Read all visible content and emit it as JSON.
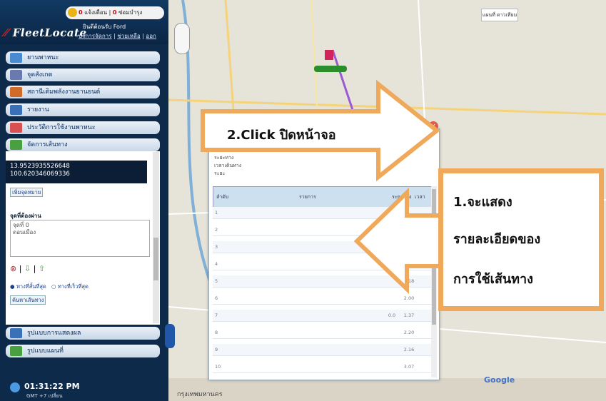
{
  "header": {
    "alert_count_1": "0",
    "alert_label_1": "แจ้งเตือน",
    "alert_count_2": "0",
    "alert_label_2": "ซ่อมบำรุง",
    "logo": "FleetLocate",
    "user_name": "ยินดีต้อนรับ Ford",
    "link_services": "บริการจัดการ",
    "link_help": "ช่วยเหลือ",
    "link_logout": "ออก"
  },
  "sidebar": {
    "items": [
      {
        "label": "ยานพาหนะ",
        "icon": "vehicle-icon",
        "color": "#4a8ad0"
      },
      {
        "label": "จุดสังเกต",
        "icon": "home-icon",
        "color": "#6a7ab0"
      },
      {
        "label": "สถานีเติมพลังงานยานยนต์",
        "icon": "fuel-pump-icon",
        "color": "#d06b2a"
      },
      {
        "label": "รายงาน",
        "icon": "report-icon",
        "color": "#3a70b8"
      },
      {
        "label": "ประวัติการใช้งานพาหนะ",
        "icon": "history-icon",
        "color": "#d85050"
      },
      {
        "label": "จัดการเส้นทาง",
        "icon": "route-icon",
        "color": "#4aa040"
      }
    ],
    "bottom_items": [
      {
        "label": "รูปแบบการแสดงผล",
        "icon": "display-icon",
        "color": "#3a70b8"
      },
      {
        "label": "รูปแบบแผนที่",
        "icon": "map-style-icon",
        "color": "#4aa040"
      }
    ]
  },
  "route_panel": {
    "lat": "13.9523935526648",
    "lng": "100.620346069336",
    "pick_button": "เพิ่มจุดหมาย",
    "waypoints_title": "จุดที่ต้องผ่าน",
    "waypoint_1": "จุดที่ 0",
    "waypoint_2": "ดอนเมือง",
    "option_shortest": "ทางที่สั้นที่สุด",
    "option_fastest": "ทางที่เร็วที่สุด",
    "search_button": "ค้นหาเส้นทาง"
  },
  "clock": {
    "time": "01:31:22 PM",
    "timezone": "GMT +7 เปลี่ยน"
  },
  "map": {
    "map_type": "แผนที่ ดาวเทียม",
    "bottom_label": "กรุงเทพมหานคร",
    "google": "Google",
    "popup_info_1": "ระยะทาง",
    "popup_info_2": "เวลาเดินทาง",
    "popup_info_3": "ระยะ",
    "table_headers": [
      "ลำดับ",
      "รายการ",
      "ระยะทาง",
      "เวลา"
    ],
    "table_rows": [
      {
        "n": "1",
        "dist": "",
        "min": ""
      },
      {
        "n": "2",
        "dist": "",
        "min": ""
      },
      {
        "n": "3",
        "dist": "",
        "min": ""
      },
      {
        "n": "4",
        "dist": "",
        "min": "4.72"
      },
      {
        "n": "5",
        "dist": "",
        "min": "1.18"
      },
      {
        "n": "6",
        "dist": "",
        "min": "2.00"
      },
      {
        "n": "7",
        "dist": "0.0",
        "min": "1.37"
      },
      {
        "n": "8",
        "dist": "",
        "min": "2.20"
      },
      {
        "n": "9",
        "dist": "",
        "min": "2.16"
      },
      {
        "n": "10",
        "dist": "",
        "min": "3.07"
      }
    ]
  },
  "annotations": {
    "click_note": "2.Click ปิดหน้าจอ",
    "detail_line_1": "1.จะแสดง",
    "detail_line_2": "รายละเอียดของ",
    "detail_line_3": "การใช้เส้นทาง",
    "arrow_color": "#f0a85a"
  }
}
